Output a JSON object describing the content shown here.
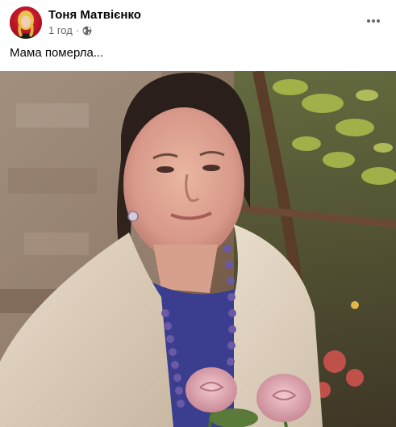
{
  "post": {
    "author": "Тоня Матвієнко",
    "time": "1 год",
    "separator": "·",
    "privacy_icon": "globe-icon",
    "text": "Мама померла...",
    "more_icon": "more-options-icon"
  }
}
